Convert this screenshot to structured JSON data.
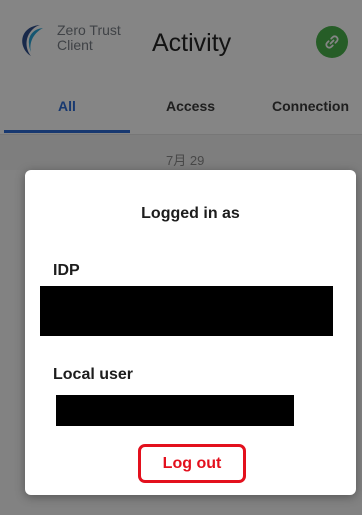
{
  "header": {
    "brand": "Zero Trust Client",
    "title": "Activity",
    "link_icon": "link-icon",
    "logo_icon": "crescent-logo-icon",
    "accent_color": "#49b34c"
  },
  "tabs": [
    {
      "label": "All",
      "active": true
    },
    {
      "label": "Access",
      "active": false
    },
    {
      "label": "Connection",
      "active": false
    }
  ],
  "list": {
    "date_label": "7月 29"
  },
  "dialog": {
    "title": "Logged in as",
    "idp_label": "IDP",
    "local_user_label": "Local user",
    "logout_label": "Log out",
    "logout_color": "#e3101d"
  }
}
